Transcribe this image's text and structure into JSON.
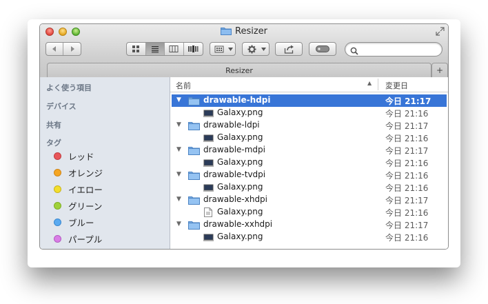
{
  "window": {
    "title": "Resizer",
    "tab_label": "Resizer",
    "tab_add": "+"
  },
  "toolbar": {
    "back_label": "◀",
    "forward_label": "▶",
    "view_modes": [
      "icon-view-icon",
      "list-view-icon",
      "column-view-icon",
      "coverflow-view-icon"
    ],
    "active_view": "list-view-icon",
    "search_placeholder": ""
  },
  "sidebar": {
    "favorites_header": "よく使う項目",
    "devices_header": "デバイス",
    "shared_header": "共有",
    "tags_header": "タグ",
    "tags": [
      {
        "label": "レッド",
        "color": "#e8565a"
      },
      {
        "label": "オレンジ",
        "color": "#f5a623"
      },
      {
        "label": "イエロー",
        "color": "#f3de2c"
      },
      {
        "label": "グリーン",
        "color": "#9fd13a"
      },
      {
        "label": "ブルー",
        "color": "#5aaaf0"
      },
      {
        "label": "パープル",
        "color": "#d97de6"
      }
    ]
  },
  "columns": {
    "name": "名前",
    "date_modified": "変更日"
  },
  "rows": [
    {
      "name": "drawable-hdpi",
      "date": "今日 21:17",
      "kind": "folder",
      "selected": true
    },
    {
      "name": "Galaxy.png",
      "date": "今日 21:16",
      "kind": "image"
    },
    {
      "name": "drawable-ldpi",
      "date": "今日 21:17",
      "kind": "folder"
    },
    {
      "name": "Galaxy.png",
      "date": "今日 21:16",
      "kind": "image"
    },
    {
      "name": "drawable-mdpi",
      "date": "今日 21:17",
      "kind": "folder"
    },
    {
      "name": "Galaxy.png",
      "date": "今日 21:16",
      "kind": "image"
    },
    {
      "name": "drawable-tvdpi",
      "date": "今日 21:16",
      "kind": "folder"
    },
    {
      "name": "Galaxy.png",
      "date": "今日 21:16",
      "kind": "image"
    },
    {
      "name": "drawable-xhdpi",
      "date": "今日 21:17",
      "kind": "folder"
    },
    {
      "name": "Galaxy.png",
      "date": "今日 21:16",
      "kind": "document"
    },
    {
      "name": "drawable-xxhdpi",
      "date": "今日 21:17",
      "kind": "folder"
    },
    {
      "name": "Galaxy.png",
      "date": "今日 21:16",
      "kind": "image"
    }
  ]
}
